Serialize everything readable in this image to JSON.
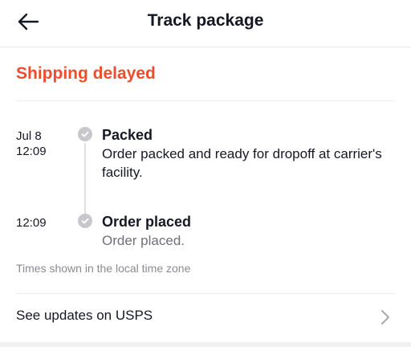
{
  "header": {
    "title": "Track package",
    "back_icon": "back-arrow-icon"
  },
  "status": {
    "text": "Shipping delayed",
    "color": "#ee4d2d"
  },
  "timeline": {
    "events": [
      {
        "date": "Jul 8",
        "time": "12:09",
        "title": "Packed",
        "description": "Order packed and ready for dropoff at carrier's facility.",
        "desc_color": "#161823"
      },
      {
        "date": "",
        "time": "12:09",
        "title": "Order placed",
        "description": "Order placed.",
        "desc_color": "#6f7079"
      }
    ],
    "dot_icon": "check-circle-icon"
  },
  "footer_note": "Times shown in the local time zone",
  "carrier_link": {
    "label": "See updates on USPS",
    "icon": "chevron-right-icon"
  }
}
